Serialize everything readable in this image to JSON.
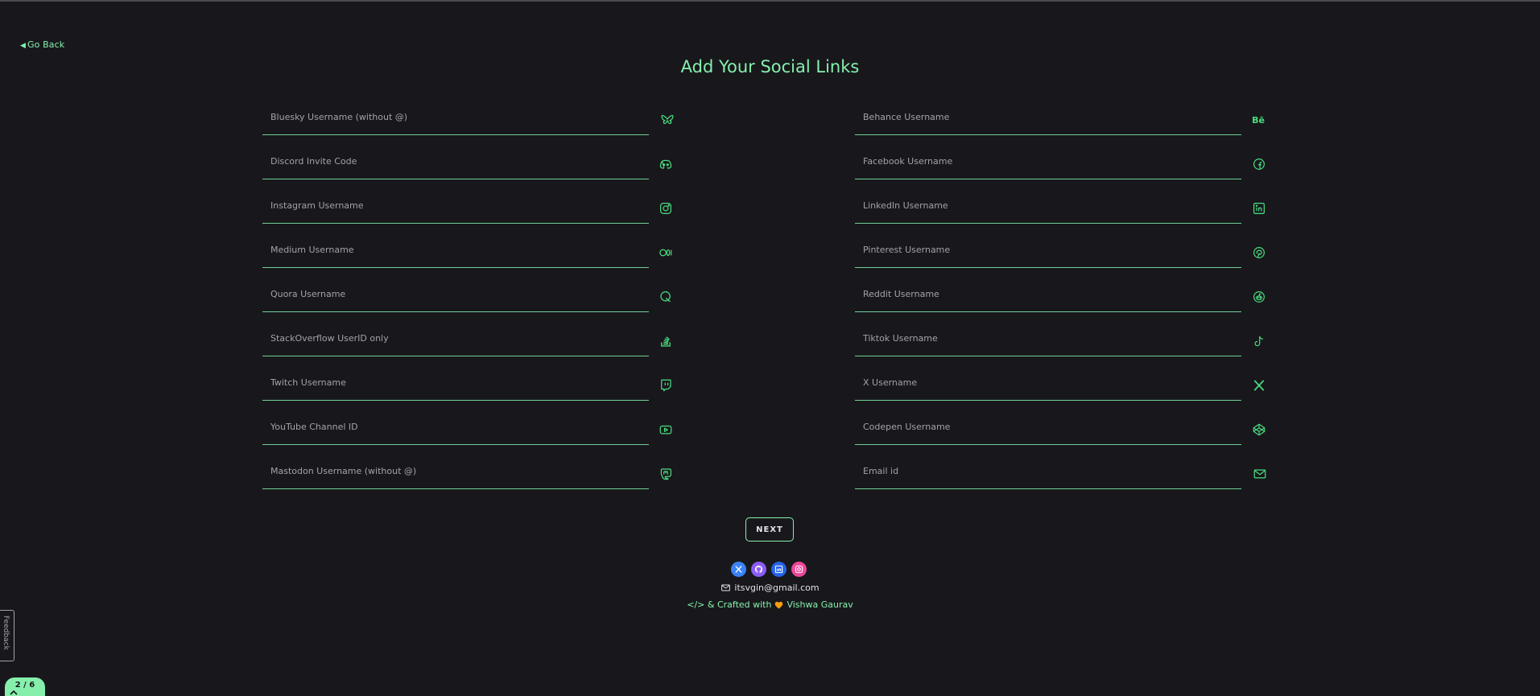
{
  "nav": {
    "back_label": "Go Back"
  },
  "page": {
    "title": "Add Your Social Links"
  },
  "left_fields": [
    {
      "placeholder": "Bluesky Username (without @)",
      "icon": "butterfly-icon"
    },
    {
      "placeholder": "Discord Invite Code",
      "icon": "discord-icon"
    },
    {
      "placeholder": "Instagram Username",
      "icon": "instagram-icon"
    },
    {
      "placeholder": "Medium Username",
      "icon": "medium-icon"
    },
    {
      "placeholder": "Quora Username",
      "icon": "quora-icon"
    },
    {
      "placeholder": "StackOverflow UserID only",
      "icon": "stackoverflow-icon"
    },
    {
      "placeholder": "Twitch Username",
      "icon": "twitch-icon"
    },
    {
      "placeholder": "YouTube Channel ID",
      "icon": "youtube-icon"
    },
    {
      "placeholder": "Mastodon Username (without @)",
      "icon": "mastodon-icon"
    }
  ],
  "right_fields": [
    {
      "placeholder": "Behance Username",
      "icon": "behance-icon",
      "icon_text": "Bē"
    },
    {
      "placeholder": "Facebook Username",
      "icon": "facebook-icon"
    },
    {
      "placeholder": "LinkedIn Username",
      "icon": "linkedin-icon"
    },
    {
      "placeholder": "Pinterest Username",
      "icon": "pinterest-icon"
    },
    {
      "placeholder": "Reddit Username",
      "icon": "reddit-icon"
    },
    {
      "placeholder": "Tiktok Username",
      "icon": "tiktok-icon"
    },
    {
      "placeholder": "X Username",
      "icon": "x-icon"
    },
    {
      "placeholder": "Codepen Username",
      "icon": "codepen-icon"
    },
    {
      "placeholder": "Email id",
      "icon": "mail-icon"
    }
  ],
  "actions": {
    "next_label": "NEXT"
  },
  "footer": {
    "socials": [
      {
        "name": "x-social-link",
        "icon": "x-icon",
        "color": "#3b82f6"
      },
      {
        "name": "github-social-link",
        "icon": "github-icon",
        "color": "#8b5cf6"
      },
      {
        "name": "linkedin-social-link",
        "icon": "linkedin-icon",
        "color": "#2563eb"
      },
      {
        "name": "instagram-social-link",
        "icon": "instagram-icon",
        "color": "#ec4899"
      }
    ],
    "email": "itsvgin@gmail.com",
    "crafted_prefix": "</> & Crafted with",
    "author": "Vishwa Gaurav"
  },
  "widgets": {
    "feedback_label": "Feedback",
    "progress_label": "2 / 6"
  },
  "colors": {
    "accent": "#86efac",
    "background": "#18181c",
    "underline": "#6fcf97"
  }
}
